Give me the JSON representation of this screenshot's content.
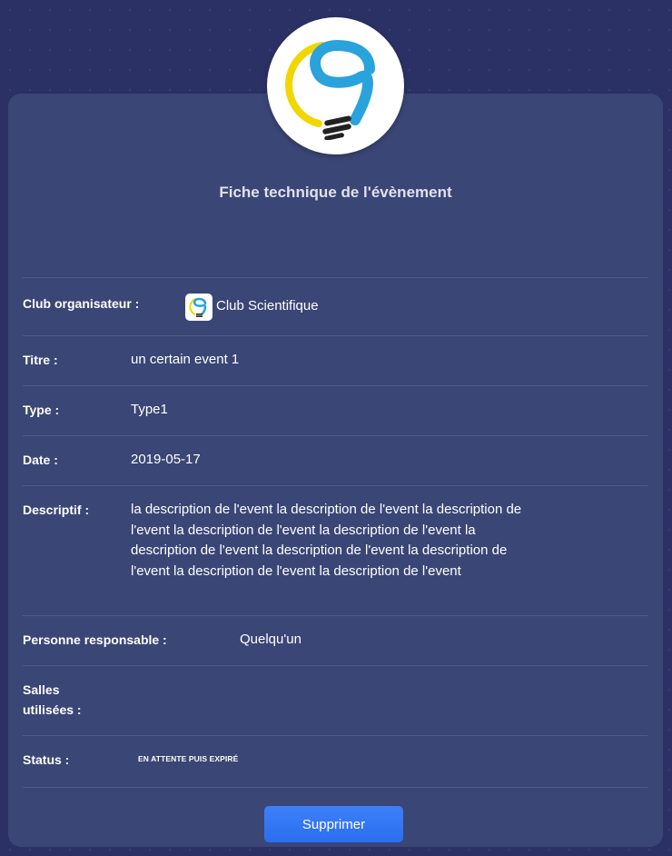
{
  "card": {
    "title": "Fiche technique de l'évènement"
  },
  "fields": {
    "club": {
      "label": "Club organisateur :",
      "value": "Club Scientifique"
    },
    "titre": {
      "label": "Titre :",
      "value": "un certain event 1"
    },
    "type": {
      "label": "Type :",
      "value": "Type1"
    },
    "date": {
      "label": "Date :",
      "value": "2019-05-17"
    },
    "descriptif": {
      "label": "Descriptif :",
      "value": "la description de l'event la description de l'event la description de l'event la description de l'event la description de l'event la description de l'event la description de l'event la description de l'event la description de l'event la description de l'event"
    },
    "responsable": {
      "label": "Personne responsable :",
      "value": "Quelqu'un"
    },
    "salles": {
      "label_line1": "Salles",
      "label_line2": "utilisées :",
      "value": ""
    },
    "status": {
      "label": "Status :",
      "value": "EN ATTENTE PUIS EXPIRÉ"
    }
  },
  "actions": {
    "delete_label": "Supprimer"
  },
  "icons": {
    "logo": "lightbulb-logo-icon",
    "club": "club-logo-icon"
  },
  "colors": {
    "background": "#2b3165",
    "card": "#3a4675",
    "button": "#2f73f3",
    "logo_blue": "#2aa3dc",
    "logo_yellow": "#f2d600"
  }
}
